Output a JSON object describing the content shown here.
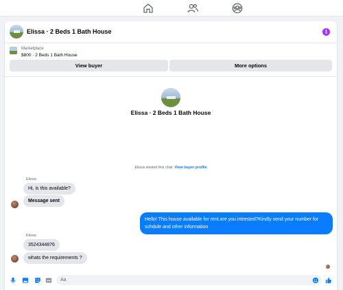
{
  "nav": {
    "icons": [
      "home-icon",
      "friends-icon",
      "groups-icon"
    ]
  },
  "header": {
    "title": "Elissa · 2 Beds 1 Bath House"
  },
  "listing": {
    "category": "Marketplace",
    "price_title": "$800 · 2 Beds 1 Bath House"
  },
  "actions": {
    "view_buyer": "View buyer",
    "more_options": "More options"
  },
  "profile": {
    "title": "Elissa · 2 Beds 1 Bath House"
  },
  "system": {
    "started_text": "Elissa started this chat.",
    "view_profile_link": "View buyer profile"
  },
  "messages": {
    "group1_sender": "Elissa",
    "m1": "Hi, is this available?",
    "m2": "Message sent",
    "m3": "Hello! This house available for rent.are you intrested?Kindly send your number for schdule and other information",
    "group2_sender": "Elissa",
    "m4": "3524344876",
    "m5": "whats the requirements ?"
  },
  "composer": {
    "placeholder": "Aa",
    "icons": [
      "microphone-icon",
      "photo-icon",
      "sticker-icon",
      "gif-icon",
      "emoji-icon",
      "like-icon"
    ]
  },
  "colors": {
    "accent": "#0a7cff",
    "info": "#a033ff",
    "link": "#1877f2"
  }
}
